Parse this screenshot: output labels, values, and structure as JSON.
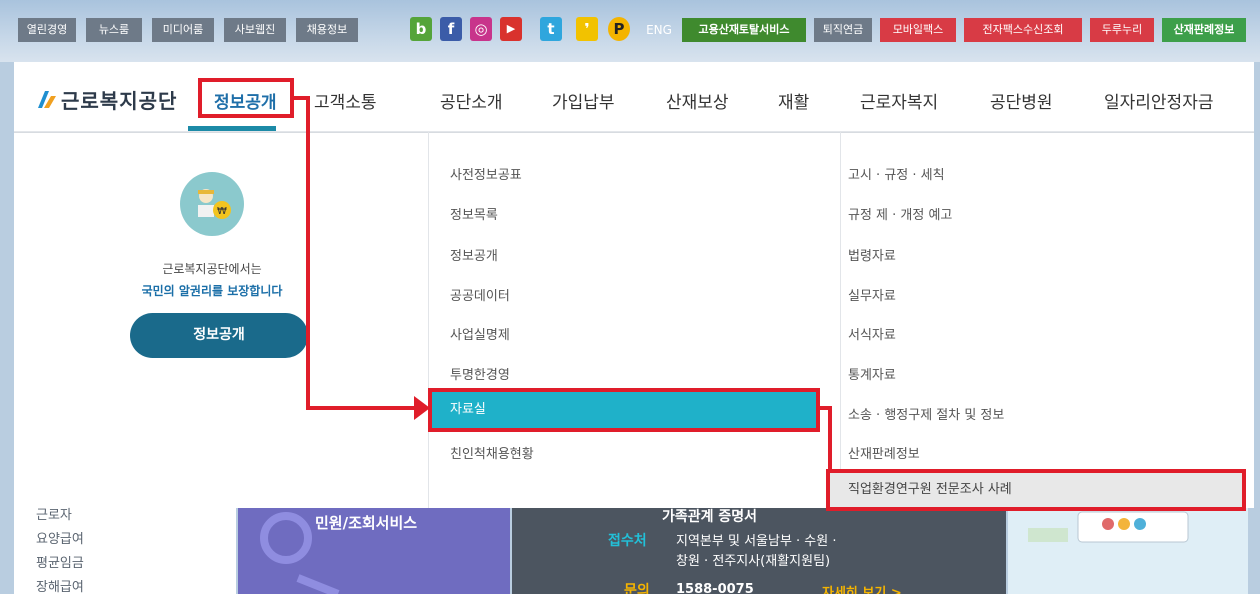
{
  "topbar": {
    "left_links": [
      "열린경영",
      "뉴스룸",
      "미디어룸",
      "사보웹진",
      "채용정보"
    ],
    "sns_icons": [
      "blog-icon",
      "facebook-icon",
      "instagram-icon",
      "youtube-icon",
      "twitter-icon",
      "kakaostory-icon",
      "post-icon"
    ],
    "sns_glyphs": [
      "b",
      "f",
      "◎",
      "▶",
      "t",
      "❜",
      "P"
    ],
    "eng_label": "ENG",
    "right_links": [
      "고용산재토탈서비스",
      "퇴직연금",
      "모바일팩스",
      "전자팩스수신조회",
      "두루누리",
      "산재판례정보"
    ]
  },
  "nav": {
    "logo_text": "근로복지공단",
    "items": [
      "정보공개",
      "고객소통",
      "공단소개",
      "가입납부",
      "산재보상",
      "재활",
      "근로자복지",
      "공단병원",
      "일자리안정자금"
    ]
  },
  "promo": {
    "line1": "근로복지공단에서는",
    "line2": "국민의 알권리를 보장합니다",
    "button_label": "정보공개"
  },
  "menu_col1": [
    "사전정보공표",
    "정보목록",
    "정보공개",
    "공공데이터",
    "사업실명제",
    "투명한경영",
    "자료실",
    "친인척채용현황"
  ],
  "menu_col2": [
    "고시 · 규정 · 세칙",
    "규정 제 · 개정 예고",
    "법령자료",
    "실무자료",
    "서식자료",
    "통계자료",
    "소송 · 행정구제 절차 및 정보",
    "산재판례정보",
    "직업환경연구원 전문조사 사례"
  ],
  "background": {
    "left_links": [
      "근로자",
      "요양급여",
      "평균임금",
      "장해급여"
    ],
    "card1_text": "민원/조회서비스",
    "card2_title": "가족관계 증명서",
    "card2_label": "접수처",
    "card2_line1": "지역본부 및 서울남부 · 수원 ·",
    "card2_line2": "창원 · 전주지사(재활지원팀)",
    "card2_phone_label": "문의",
    "card2_phone": "1588-0075",
    "card2_more": "자세히 보기 >"
  },
  "colors": {
    "active_nav": "#1f6fa9",
    "active_menu_bg": "#1fb1c9",
    "annotation_red": "#e01d2a",
    "promo_button": "#1a6a8b"
  }
}
